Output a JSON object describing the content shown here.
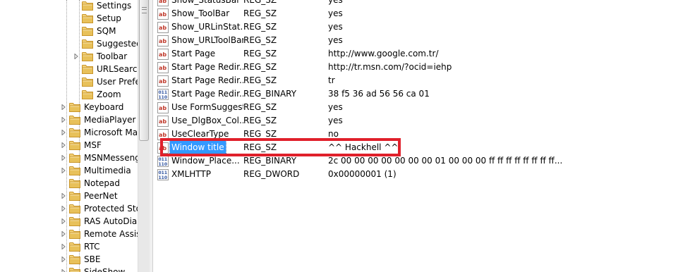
{
  "colors": {
    "selection": "#3399ff",
    "annotation_box": "#e0202b",
    "folder": "#e8c15a"
  },
  "tree": {
    "items": [
      {
        "label": "Settings",
        "level": 2,
        "expandable": false,
        "icon": "folder-icon"
      },
      {
        "label": "Setup",
        "level": 2,
        "expandable": false,
        "icon": "folder-icon"
      },
      {
        "label": "SQM",
        "level": 2,
        "expandable": false,
        "icon": "folder-icon"
      },
      {
        "label": "Suggested",
        "level": 2,
        "expandable": false,
        "icon": "folder-icon"
      },
      {
        "label": "Toolbar",
        "level": 2,
        "expandable": true,
        "icon": "folder-icon"
      },
      {
        "label": "URLSearch",
        "level": 2,
        "expandable": false,
        "icon": "folder-icon"
      },
      {
        "label": "User Prefer",
        "level": 2,
        "expandable": false,
        "icon": "folder-icon"
      },
      {
        "label": "Zoom",
        "level": 2,
        "expandable": false,
        "icon": "folder-icon"
      },
      {
        "label": "Keyboard",
        "level": 1,
        "expandable": true,
        "icon": "folder-icon"
      },
      {
        "label": "MediaPlayer",
        "level": 1,
        "expandable": true,
        "icon": "folder-icon"
      },
      {
        "label": "Microsoft Mar",
        "level": 1,
        "expandable": true,
        "icon": "folder-icon"
      },
      {
        "label": "MSF",
        "level": 1,
        "expandable": true,
        "icon": "folder-icon"
      },
      {
        "label": "MSNMessenge",
        "level": 1,
        "expandable": true,
        "icon": "folder-icon"
      },
      {
        "label": "Multimedia",
        "level": 1,
        "expandable": true,
        "icon": "folder-icon"
      },
      {
        "label": "Notepad",
        "level": 1,
        "expandable": false,
        "icon": "folder-icon"
      },
      {
        "label": "PeerNet",
        "level": 1,
        "expandable": true,
        "icon": "folder-icon"
      },
      {
        "label": "Protected Stor",
        "level": 1,
        "expandable": true,
        "icon": "folder-icon"
      },
      {
        "label": "RAS AutoDial",
        "level": 1,
        "expandable": true,
        "icon": "folder-icon"
      },
      {
        "label": "Remote Assista",
        "level": 1,
        "expandable": true,
        "icon": "folder-icon"
      },
      {
        "label": "RTC",
        "level": 1,
        "expandable": true,
        "icon": "folder-icon"
      },
      {
        "label": "SBE",
        "level": 1,
        "expandable": true,
        "icon": "folder-icon"
      },
      {
        "label": "SideShow",
        "level": 1,
        "expandable": true,
        "icon": "folder-icon"
      }
    ]
  },
  "values": {
    "rows": [
      {
        "name": "Show_StatusBar",
        "type": "REG_SZ",
        "data": "yes",
        "icon": "string-value-icon",
        "selected": false
      },
      {
        "name": "Show_ToolBar",
        "type": "REG_SZ",
        "data": "yes",
        "icon": "string-value-icon",
        "selected": false
      },
      {
        "name": "Show_URLinStat...",
        "type": "REG_SZ",
        "data": "yes",
        "icon": "string-value-icon",
        "selected": false
      },
      {
        "name": "Show_URLToolBar",
        "type": "REG_SZ",
        "data": "yes",
        "icon": "string-value-icon",
        "selected": false
      },
      {
        "name": "Start Page",
        "type": "REG_SZ",
        "data": "http://www.google.com.tr/",
        "icon": "string-value-icon",
        "selected": false
      },
      {
        "name": "Start Page Redir...",
        "type": "REG_SZ",
        "data": "http://tr.msn.com/?ocid=iehp",
        "icon": "string-value-icon",
        "selected": false
      },
      {
        "name": "Start Page Redir...",
        "type": "REG_SZ",
        "data": "tr",
        "icon": "string-value-icon",
        "selected": false
      },
      {
        "name": "Start Page Redir...",
        "type": "REG_BINARY",
        "data": "38 f5 36 ad 56 56 ca 01",
        "icon": "binary-value-icon",
        "selected": false
      },
      {
        "name": "Use FormSuggest",
        "type": "REG_SZ",
        "data": "yes",
        "icon": "string-value-icon",
        "selected": false
      },
      {
        "name": "Use_DlgBox_Col...",
        "type": "REG_SZ",
        "data": "yes",
        "icon": "string-value-icon",
        "selected": false
      },
      {
        "name": "UseClearType",
        "type": "REG_SZ",
        "data": "no",
        "icon": "string-value-icon",
        "selected": false
      },
      {
        "name": "Window title",
        "type": "REG_SZ",
        "data": "^^ Hackhell ^^",
        "icon": "string-value-icon",
        "selected": true
      },
      {
        "name": "Window_Place...",
        "type": "REG_BINARY",
        "data": "2c 00 00 00 00 00 00 00 01 00 00 00 ff ff ff ff ff ff ff ff...",
        "icon": "binary-value-icon",
        "selected": false
      },
      {
        "name": "XMLHTTP",
        "type": "REG_DWORD",
        "data": "0x00000001 (1)",
        "icon": "binary-value-icon",
        "selected": false
      }
    ]
  }
}
